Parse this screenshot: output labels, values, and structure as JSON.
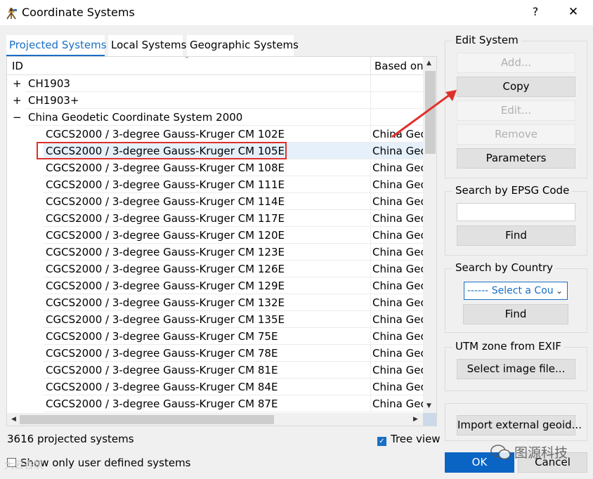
{
  "window": {
    "title": "Coordinate Systems",
    "help_glyph": "?",
    "close_glyph": "✕",
    "icon": "surveyor-icon"
  },
  "tabs": [
    {
      "label": "Projected Systems",
      "active": true
    },
    {
      "label": "Local Systems",
      "active": false
    },
    {
      "label": "Geographic Systems",
      "active": false
    }
  ],
  "tree": {
    "columns": {
      "id": "ID",
      "based_on": "Based on",
      "sort_glyph": "ˆ"
    },
    "rows": [
      {
        "expander": "+",
        "label": "CH1903",
        "based_on": "",
        "level": 0
      },
      {
        "expander": "+",
        "label": "CH1903+",
        "based_on": "",
        "level": 0
      },
      {
        "expander": "−",
        "label": "China Geodetic Coordinate System 2000",
        "based_on": "",
        "level": 0
      },
      {
        "expander": "",
        "label": "CGCS2000 / 3-degree Gauss-Kruger CM 102E",
        "based_on": "China Geo",
        "level": 1
      },
      {
        "expander": "",
        "label": "CGCS2000 / 3-degree Gauss-Kruger CM 105E",
        "based_on": "China Geo",
        "level": 1,
        "selected": true
      },
      {
        "expander": "",
        "label": "CGCS2000 / 3-degree Gauss-Kruger CM 108E",
        "based_on": "China Geo",
        "level": 1
      },
      {
        "expander": "",
        "label": "CGCS2000 / 3-degree Gauss-Kruger CM 111E",
        "based_on": "China Geo",
        "level": 1
      },
      {
        "expander": "",
        "label": "CGCS2000 / 3-degree Gauss-Kruger CM 114E",
        "based_on": "China Geo",
        "level": 1
      },
      {
        "expander": "",
        "label": "CGCS2000 / 3-degree Gauss-Kruger CM 117E",
        "based_on": "China Geo",
        "level": 1
      },
      {
        "expander": "",
        "label": "CGCS2000 / 3-degree Gauss-Kruger CM 120E",
        "based_on": "China Geo",
        "level": 1
      },
      {
        "expander": "",
        "label": "CGCS2000 / 3-degree Gauss-Kruger CM 123E",
        "based_on": "China Geo",
        "level": 1
      },
      {
        "expander": "",
        "label": "CGCS2000 / 3-degree Gauss-Kruger CM 126E",
        "based_on": "China Geo",
        "level": 1
      },
      {
        "expander": "",
        "label": "CGCS2000 / 3-degree Gauss-Kruger CM 129E",
        "based_on": "China Geo",
        "level": 1
      },
      {
        "expander": "",
        "label": "CGCS2000 / 3-degree Gauss-Kruger CM 132E",
        "based_on": "China Geo",
        "level": 1
      },
      {
        "expander": "",
        "label": "CGCS2000 / 3-degree Gauss-Kruger CM 135E",
        "based_on": "China Geo",
        "level": 1
      },
      {
        "expander": "",
        "label": "CGCS2000 / 3-degree Gauss-Kruger CM 75E",
        "based_on": "China Geo",
        "level": 1
      },
      {
        "expander": "",
        "label": "CGCS2000 / 3-degree Gauss-Kruger CM 78E",
        "based_on": "China Geo",
        "level": 1
      },
      {
        "expander": "",
        "label": "CGCS2000 / 3-degree Gauss-Kruger CM 81E",
        "based_on": "China Geo",
        "level": 1
      },
      {
        "expander": "",
        "label": "CGCS2000 / 3-degree Gauss-Kruger CM 84E",
        "based_on": "China Geo",
        "level": 1
      },
      {
        "expander": "",
        "label": "CGCS2000 / 3-degree Gauss-Kruger CM 87E",
        "based_on": "China Geo",
        "level": 1
      }
    ]
  },
  "status": {
    "count_text": "3616 projected systems",
    "tree_view_label": "Tree view",
    "tree_view_checked": true,
    "user_only_label": "Show only user defined systems",
    "user_only_checked": false
  },
  "edit_system": {
    "title": "Edit System",
    "add": "Add...",
    "copy": "Copy",
    "edit": "Edit...",
    "remove": "Remove",
    "parameters": "Parameters"
  },
  "search_epsg": {
    "title": "Search by EPSG Code",
    "input_value": "",
    "find": "Find"
  },
  "search_country": {
    "title": "Search by Country",
    "selected": "------ Select a Cou",
    "find": "Find"
  },
  "utm_exif": {
    "title": "UTM zone from EXIF",
    "button": "Select image file..."
  },
  "import_geoid": {
    "button": "Import external geoid..."
  },
  "dialog": {
    "ok": "OK",
    "cancel": "Cancel"
  },
  "watermark": {
    "text": "图源科技",
    "left_text": "大云杏筑"
  },
  "colors": {
    "accent": "#1a6fc4",
    "highlight_border": "#e0302a",
    "selection_bg": "#e5f0fb",
    "ok_bg": "#0a64c4"
  }
}
